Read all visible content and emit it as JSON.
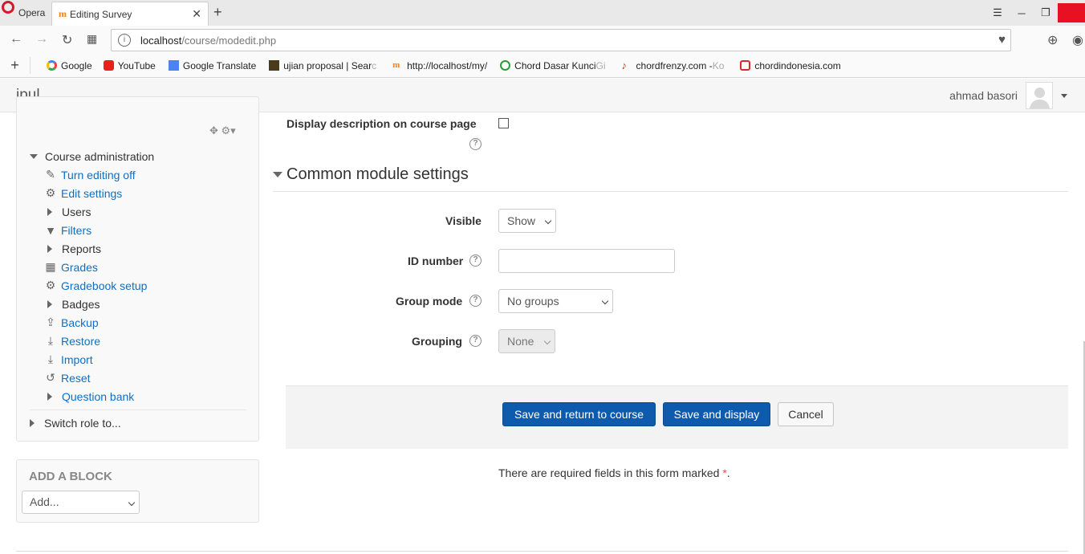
{
  "browser": {
    "app_name": "Opera",
    "tab_title": "Editing Survey",
    "url_host": "localhost",
    "url_path": "/course/modedit.php",
    "bookmarks": [
      {
        "label": "Google",
        "faded": ""
      },
      {
        "label": "YouTube",
        "faded": ""
      },
      {
        "label": "Google Translate",
        "faded": ""
      },
      {
        "label": "ujian proposal | Sear",
        "faded": "c"
      },
      {
        "label": "http://localhost/my/",
        "faded": ""
      },
      {
        "label": "Chord Dasar Kunci ",
        "faded": "Gi"
      },
      {
        "label": "chordfrenzy.com - ",
        "faded": "Ko"
      },
      {
        "label": "chordindonesia.com",
        "faded": ""
      }
    ],
    "colors": {
      "opera_red": "#d4192c",
      "moodle_orange": "#f98012"
    }
  },
  "site": {
    "brand": "ipul",
    "username": "ahmad basori"
  },
  "sidebar": {
    "course_admin_label": "Course administration",
    "items": [
      {
        "label": "Turn editing off",
        "icon": "pencil-icon"
      },
      {
        "label": "Edit settings",
        "icon": "gear-icon"
      },
      {
        "label": "Users",
        "icon": "expand-arrow-icon"
      },
      {
        "label": "Filters",
        "icon": "filter-icon"
      },
      {
        "label": "Reports",
        "icon": "expand-arrow-icon"
      },
      {
        "label": "Grades",
        "icon": "table-icon"
      },
      {
        "label": "Gradebook setup",
        "icon": "gear-icon"
      },
      {
        "label": "Badges",
        "icon": "expand-arrow-icon"
      },
      {
        "label": "Backup",
        "icon": "upload-icon"
      },
      {
        "label": "Restore",
        "icon": "download-icon"
      },
      {
        "label": "Import",
        "icon": "download-icon"
      },
      {
        "label": "Reset",
        "icon": "reset-icon"
      },
      {
        "label": "Question bank",
        "icon": "expand-arrow-icon"
      }
    ],
    "switch_role_label": "Switch role to...",
    "add_block_title": "ADD A BLOCK",
    "add_block_select": "Add..."
  },
  "form": {
    "display_description_label": "Display description on course page",
    "section_title": "Common module settings",
    "visible_label": "Visible",
    "visible_value": "Show",
    "id_number_label": "ID number",
    "id_number_value": "",
    "group_mode_label": "Group mode",
    "group_mode_value": "No groups",
    "grouping_label": "Grouping",
    "grouping_value": "None",
    "save_return_label": "Save and return to course",
    "save_display_label": "Save and display",
    "cancel_label": "Cancel",
    "required_note": "There are required fields in this form marked",
    "required_star": "*",
    "required_end": "."
  }
}
